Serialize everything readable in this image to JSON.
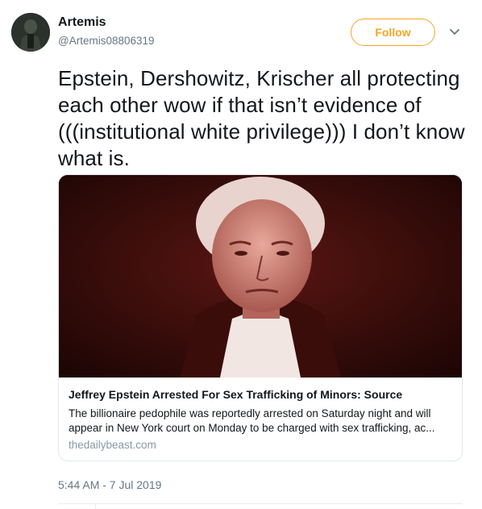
{
  "user": {
    "display_name": "Artemis",
    "handle": "@Artemis08806319"
  },
  "follow": {
    "label": "Follow"
  },
  "tweet": {
    "text": "Epstein, Dershowitz, Krischer all protecting each other wow if that isn’t evidence of (((institutional white privilege))) I don’t know what is.",
    "timestamp": "5:44 AM - 7 Jul 2019"
  },
  "card": {
    "title": "Jeffrey Epstein Arrested For Sex Trafficking of Minors: Source",
    "description": "The billionaire pedophile was reportedly arrested on Saturday night and will appear in New York court on Monday to be charged with sex trafficking, ac...",
    "domain": "thedailybeast.com"
  },
  "colors": {
    "accent": "#f5a623",
    "secondary_text": "#657786",
    "border": "#e1e8ed"
  },
  "icons": {
    "menu": "chevron-down-icon"
  }
}
